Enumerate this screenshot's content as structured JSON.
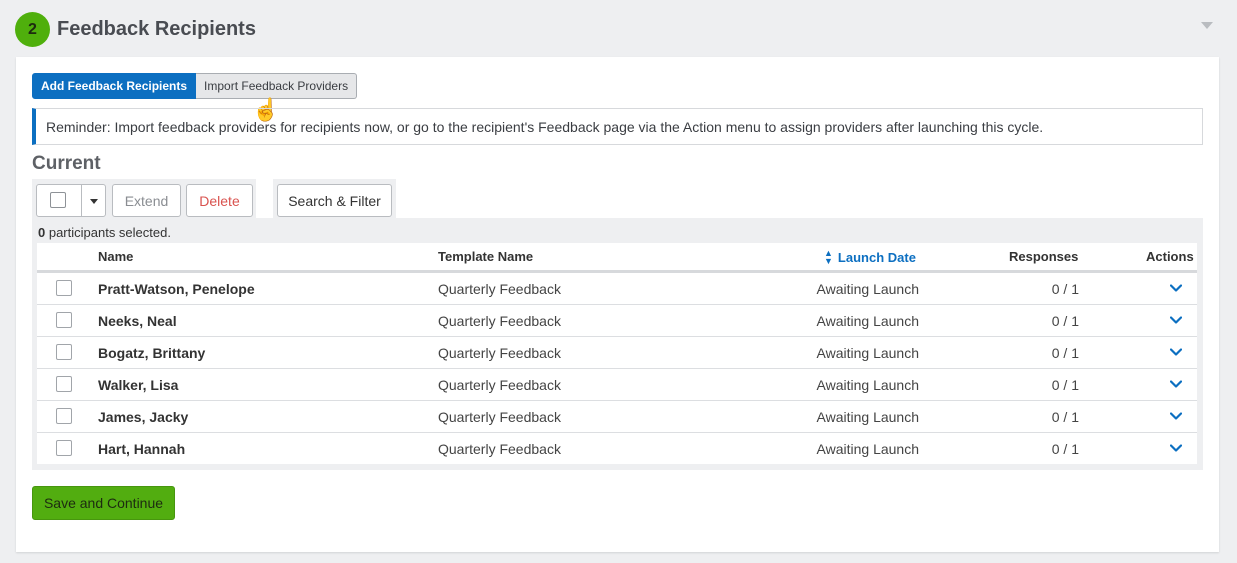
{
  "section": {
    "step_number": "2",
    "title": "Feedback Recipients"
  },
  "tabs": {
    "add_label": "Add Feedback Recipients",
    "import_label": "Import Feedback Providers"
  },
  "reminder": "Reminder: Import feedback providers for recipients now, or go to the recipient's Feedback page via the Action menu to assign providers after launching this cycle.",
  "current_heading": "Current",
  "toolbar": {
    "extend_label": "Extend",
    "delete_label": "Delete",
    "search_label": "Search & Filter"
  },
  "selection": {
    "count": "0",
    "suffix": " participants selected."
  },
  "table": {
    "headers": {
      "name": "Name",
      "template": "Template Name",
      "launch": "Launch Date",
      "responses": "Responses",
      "actions": "Actions"
    },
    "rows": [
      {
        "name": "Pratt-Watson, Penelope",
        "template": "Quarterly Feedback",
        "launch": "Awaiting Launch",
        "responses": "0 / 1"
      },
      {
        "name": "Neeks, Neal",
        "template": "Quarterly Feedback",
        "launch": "Awaiting Launch",
        "responses": "0 / 1"
      },
      {
        "name": "Bogatz, Brittany",
        "template": "Quarterly Feedback",
        "launch": "Awaiting Launch",
        "responses": "0 / 1"
      },
      {
        "name": "Walker, Lisa",
        "template": "Quarterly Feedback",
        "launch": "Awaiting Launch",
        "responses": "0 / 1"
      },
      {
        "name": "James, Jacky",
        "template": "Quarterly Feedback",
        "launch": "Awaiting Launch",
        "responses": "0 / 1"
      },
      {
        "name": "Hart, Hannah",
        "template": "Quarterly Feedback",
        "launch": "Awaiting Launch",
        "responses": "0 / 1"
      }
    ]
  },
  "save_label": "Save and Continue",
  "colors": {
    "accent_blue": "#0c6fc1",
    "success_green": "#52ad10",
    "delete_red": "#d9534f"
  }
}
